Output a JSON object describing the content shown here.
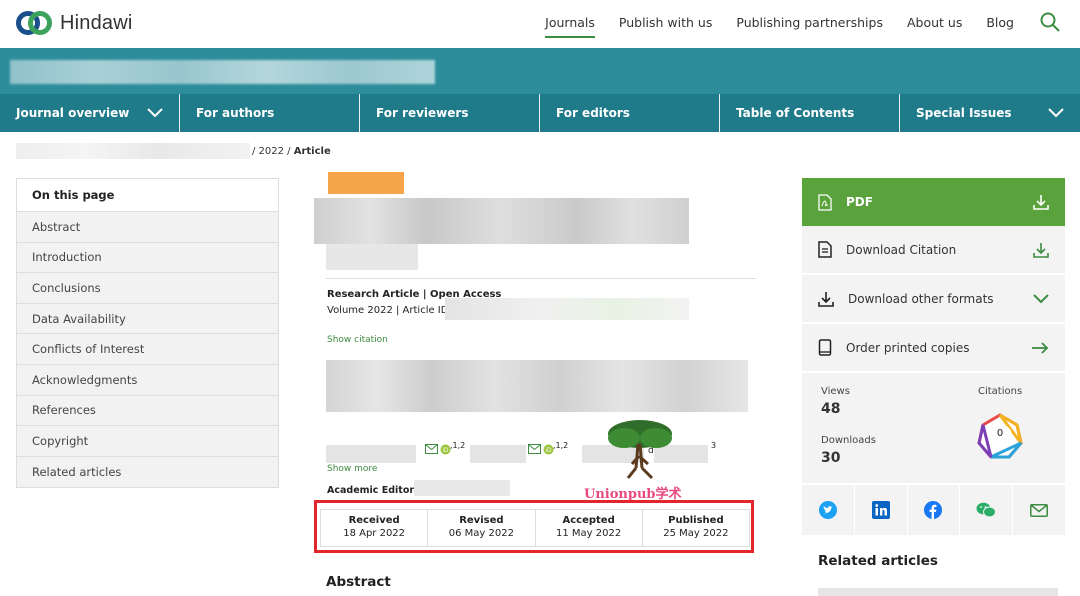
{
  "header": {
    "brand": "Hindawi",
    "nav": [
      "Journals",
      "Publish with us",
      "Publishing partnerships",
      "About us",
      "Blog"
    ],
    "active_nav": "Journals"
  },
  "journal_nav": [
    "Journal overview",
    "For authors",
    "For reviewers",
    "For editors",
    "Table of Contents",
    "Special Issues"
  ],
  "breadcrumb": {
    "year": "/ 2022 /",
    "current": "Article"
  },
  "sidebar": {
    "heading": "On this page",
    "items": [
      "Abstract",
      "Introduction",
      "Conclusions",
      "Data Availability",
      "Conflicts of Interest",
      "Acknowledgments",
      "References",
      "Copyright",
      "Related articles"
    ]
  },
  "article": {
    "type_line": "Research Article | Open Access",
    "volume_line": "Volume 2022 | Article ID",
    "show_citation": "Show citation",
    "author_sup_1": ",1,2",
    "author_sup_2": ",1,2",
    "author_sup_3": "3",
    "author_frag": "d",
    "show_more": "Show more",
    "academic_editor": "Academic Editor:",
    "abstract_heading": "Abstract"
  },
  "dates": [
    {
      "label": "Received",
      "value": "18 Apr 2022"
    },
    {
      "label": "Revised",
      "value": "06 May 2022"
    },
    {
      "label": "Accepted",
      "value": "11 May 2022"
    },
    {
      "label": "Published",
      "value": "25 May 2022"
    }
  ],
  "right_panel": {
    "pdf": "PDF",
    "download_citation": "Download Citation",
    "download_other": "Download other formats",
    "order_printed": "Order printed copies",
    "views_label": "Views",
    "views": "48",
    "downloads_label": "Downloads",
    "downloads": "30",
    "citations_label": "Citations",
    "citations": "0",
    "related_heading": "Related articles"
  },
  "watermark": "Unionpub学术",
  "colors": {
    "brand_green": "#3d8c40",
    "banner_teal": "#2e8d9b",
    "nav_teal": "#1f7a8a",
    "pdf_green": "#5aa23c",
    "highlight_red": "#e3262b"
  }
}
